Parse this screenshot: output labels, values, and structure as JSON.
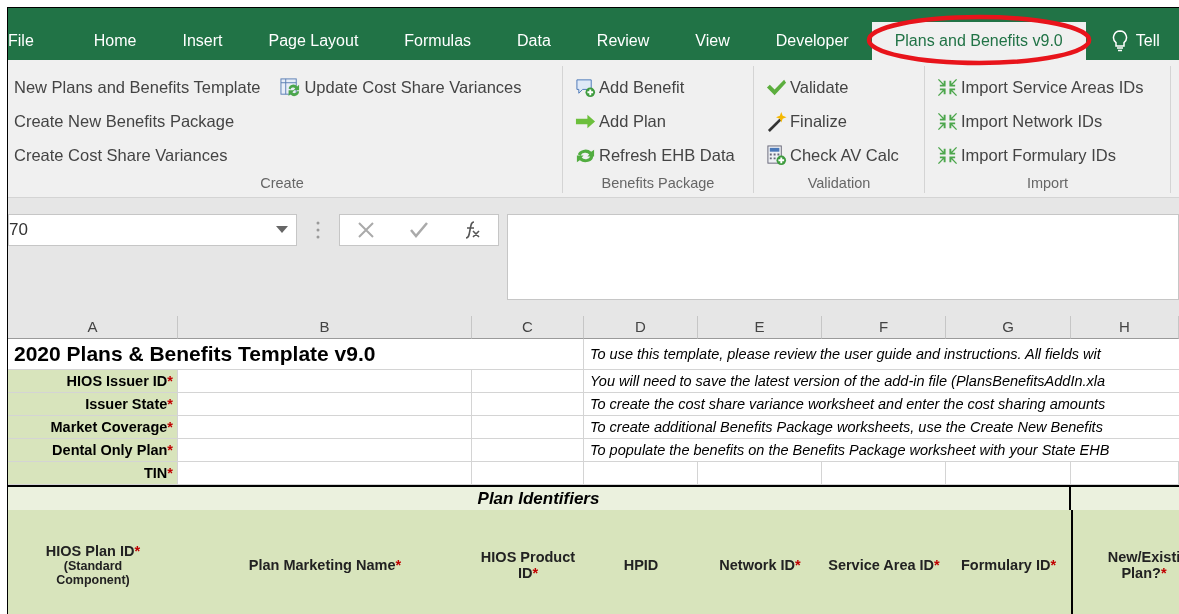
{
  "ribbon_tabs": [
    {
      "label": "File",
      "selected": false
    },
    {
      "label": "Home",
      "selected": false
    },
    {
      "label": "Insert",
      "selected": false
    },
    {
      "label": "Page Layout",
      "selected": false
    },
    {
      "label": "Formulas",
      "selected": false
    },
    {
      "label": "Data",
      "selected": false
    },
    {
      "label": "Review",
      "selected": false
    },
    {
      "label": "View",
      "selected": false
    },
    {
      "label": "Developer",
      "selected": false
    },
    {
      "label": "Plans and Benefits v9.0",
      "selected": true
    }
  ],
  "tell_me": "Tell",
  "ribbon_groups": [
    {
      "label": "Create",
      "columns": [
        [
          {
            "label": "New Plans and Benefits Template"
          },
          {
            "label": "Create New Benefits Package"
          },
          {
            "label": "Create Cost Share Variances"
          }
        ],
        [
          {
            "label": "Update Cost Share Variances",
            "kind": "sheet-refresh"
          }
        ]
      ]
    },
    {
      "label": "Benefits Package",
      "columns": [
        [
          {
            "label": "Add Benefit",
            "kind": "comment-add"
          },
          {
            "label": "Add Plan",
            "kind": "arrow-right"
          },
          {
            "label": "Refresh EHB Data",
            "kind": "refresh"
          }
        ]
      ]
    },
    {
      "label": "Validation",
      "columns": [
        [
          {
            "label": "Validate",
            "kind": "check"
          },
          {
            "label": "Finalize",
            "kind": "wand"
          },
          {
            "label": "Check AV Calc",
            "kind": "calculator"
          }
        ]
      ]
    },
    {
      "label": "Import",
      "columns": [
        [
          {
            "label": "Import Service Areas IDs",
            "kind": "import"
          },
          {
            "label": "Import Network IDs",
            "kind": "import"
          },
          {
            "label": "Import Formulary IDs",
            "kind": "import"
          }
        ]
      ]
    }
  ],
  "name_box": {
    "value": "70"
  },
  "sheet": {
    "columns": [
      "A",
      "B",
      "C",
      "D",
      "E",
      "F",
      "G",
      "H"
    ],
    "title": "2020 Plans & Benefits Template v9.0",
    "issuer_fields": [
      {
        "label": "HIOS Issuer ID",
        "mark": "*"
      },
      {
        "label": "Issuer State",
        "mark": "*"
      },
      {
        "label": "Market Coverage",
        "mark": "*"
      },
      {
        "label": "Dental Only Plan",
        "mark": "*"
      },
      {
        "label": "TIN",
        "mark": "*"
      }
    ],
    "instructions": [
      "To use this template, please review the user guide and instructions. All fields wit",
      "You will need to save the latest version of the add-in file (PlansBenefitsAddIn.xla",
      "To create the cost share variance worksheet and enter the cost sharing amounts",
      "To create additional Benefits Package worksheets, use the Create New Benefits",
      "To populate the benefits on the Benefits Package worksheet with your State EHB"
    ],
    "section_title": "Plan Identifiers",
    "headers": [
      {
        "label": "HIOS Plan ID",
        "mark": "*",
        "note": "(Standard Component)"
      },
      {
        "label": "Plan Marketing Name",
        "mark": "*"
      },
      {
        "label": "HIOS Product ID",
        "mark": "*"
      },
      {
        "label": "HPID"
      },
      {
        "label": "Network ID",
        "mark": "*"
      },
      {
        "label": "Service Area ID",
        "mark": "*"
      },
      {
        "label": "Formulary ID",
        "mark": "*"
      },
      {
        "label": "New/Existi Plan?",
        "mark": "*"
      }
    ]
  }
}
